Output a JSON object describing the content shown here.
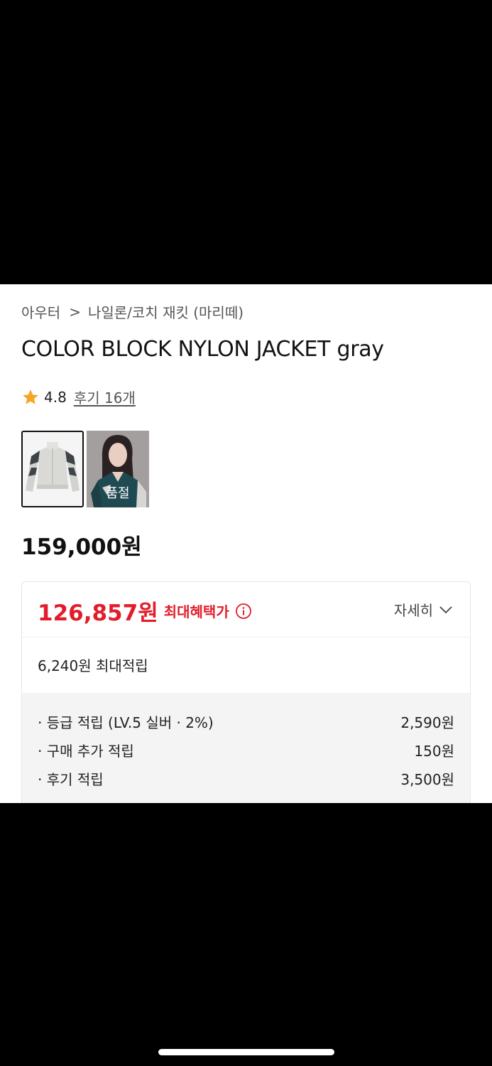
{
  "breadcrumb": {
    "category": "아우터",
    "separator": ">",
    "subcategory": "나일론/코치 재킷 (마리떼)"
  },
  "product": {
    "title": "COLOR BLOCK NYLON JACKET gray",
    "rating": "4.8",
    "reviews_link": "후기 16개",
    "price": "159,000원",
    "thumbnails": [
      {
        "name": "jacket-photo",
        "selected": true
      },
      {
        "name": "model-photo",
        "badge": "품절"
      }
    ]
  },
  "benefit": {
    "max_price": "126,857원",
    "max_label": "최대혜택가",
    "details_label": "자세히",
    "points_total": "6,240원 최대적립",
    "rows": [
      {
        "label": "· 등급 적립 (LV.5 실버 · 2%)",
        "value": "2,590원"
      },
      {
        "label": "· 구매 추가 적립",
        "value": "150원"
      },
      {
        "label": "· 후기 적립",
        "value": "3,500원"
      }
    ]
  },
  "colors": {
    "accent_red": "#e21d2b",
    "star": "#f5a623",
    "text": "#111111"
  },
  "icons": [
    "chevron-right-icon",
    "star-icon",
    "info-icon",
    "chevron-down-icon"
  ]
}
